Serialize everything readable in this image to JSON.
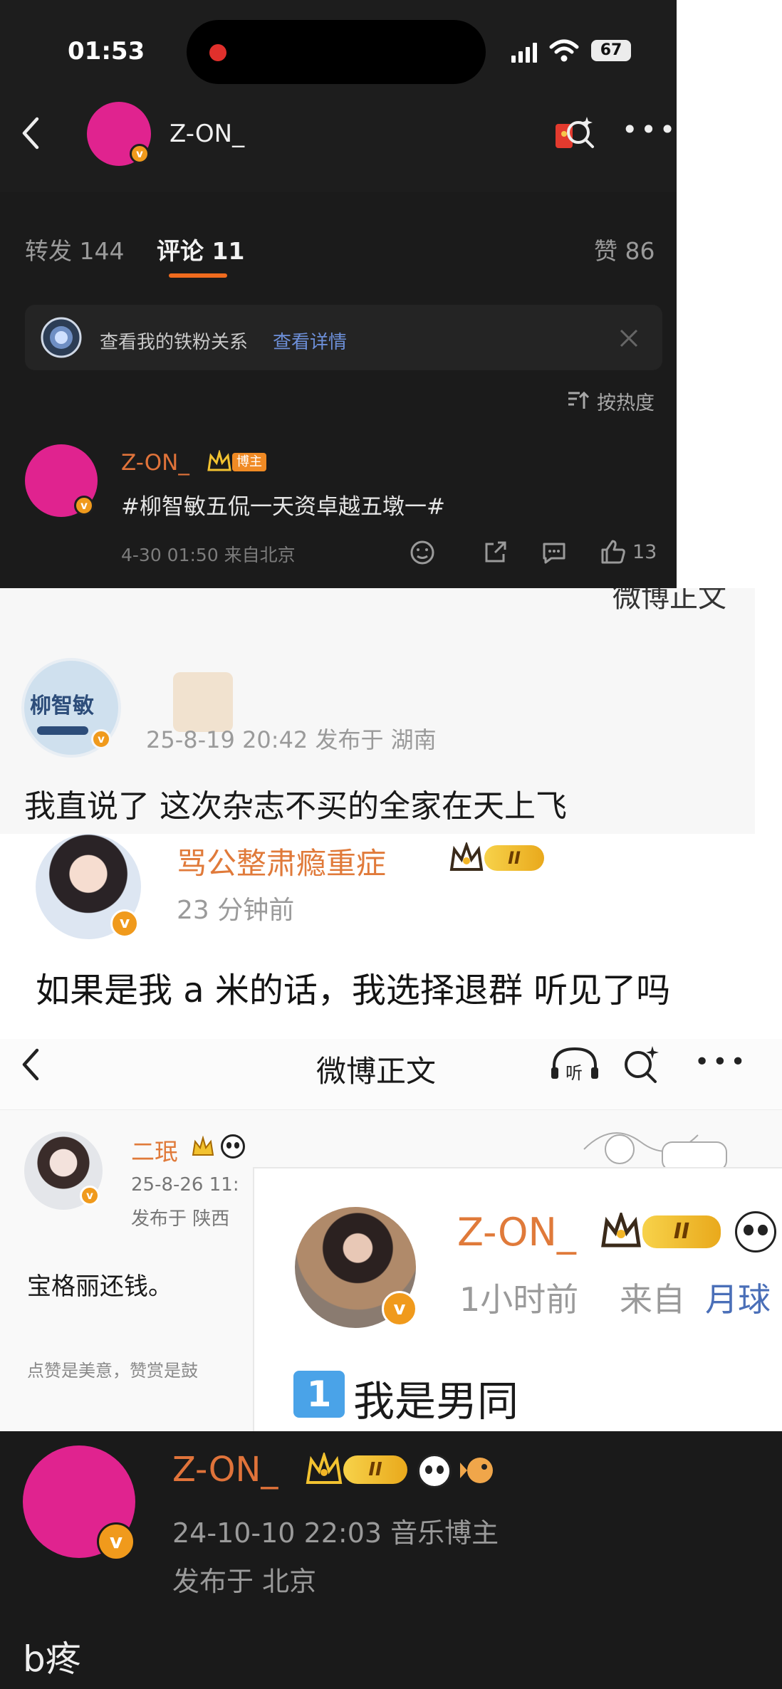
{
  "panel1": {
    "status_time": "01:53",
    "battery": "67",
    "username": "Z-ON_",
    "tabs": {
      "repost": "转发 144",
      "comment": "评论 11",
      "like": "赞 86"
    },
    "banner_text": "查看我的铁粉关系",
    "banner_link": "查看详情",
    "sort_label": "按热度",
    "comment": {
      "username": "Z-ON_",
      "tag": "博主",
      "text": "#柳智敏五侃一天资卓越五墩一#",
      "meta": "4-30 01:50 来自北京",
      "likes": "13"
    },
    "colors": {
      "accent": "#f06b1e",
      "avatar": "#e0238f",
      "vip": "#f09a1c"
    }
  },
  "panel2": {
    "cut_title": "微博正文",
    "avatar_text": "柳智敏",
    "meta": "25-8-19 20:42  发布于 湖南",
    "text": "我直说了 这次杂志不买的全家在天上飞"
  },
  "panel3": {
    "username": "骂公整肃瘾重症",
    "level": "II",
    "time": "23 分钟前",
    "text": "如果是我 a 米的话，我选择退群 听见了吗"
  },
  "panel4": {
    "title": "微博正文",
    "listen_label": "听",
    "user_a": {
      "name": "二珉",
      "date": "25-8-26 11:",
      "location": "发布于 陕西",
      "text": "宝格丽还钱。",
      "footer": "点赞是美意，赞赏是鼓"
    },
    "user_b": {
      "name": "Z-ON_",
      "level": "II",
      "time": "1小时前",
      "from": "来自",
      "source": "月球",
      "number_emoji": "1",
      "text": "我是男同"
    }
  },
  "panel5": {
    "username": "Z-ON_",
    "level": "II",
    "meta": "24-10-10 22:03  音乐博主",
    "location": "发布于 北京",
    "text": "b疼"
  }
}
